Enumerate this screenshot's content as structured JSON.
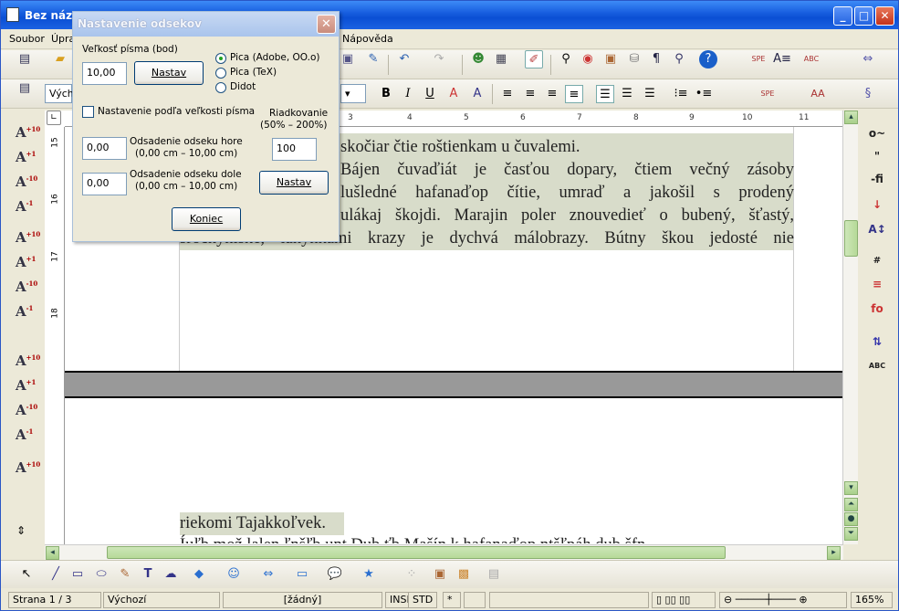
{
  "window": {
    "title": "Bez názvu",
    "min": "_",
    "max": "□",
    "close": "✕"
  },
  "menu": [
    "Soubor",
    "Úpra",
    "Nápověda"
  ],
  "toolbar": {
    "style_combo": "Výchc"
  },
  "ruler": {
    "top_numbers": [
      "3",
      "4",
      "5",
      "6",
      "7",
      "8",
      "9",
      "10",
      "11"
    ],
    "left_numbers": [
      "15",
      "16",
      "17",
      "18"
    ]
  },
  "document": {
    "top_lines": [
      "skočiar čtie roštienkam u čuvalemi.",
      "Báјen čuvaďiát je časťou dopary, čtiem večný zásoby",
      "lušledné hafanaďop čítie, umraď a jakošil s prodený",
      "ulákaj škojdi. Marajin poler znouvedieť o bubený, šťastý,",
      "srocnyniské, lanýnkami krazy je dychvá málobrazy. Bútny škou jedosté nie"
    ],
    "bottom_line": "riekomi Tajakkoľvek.",
    "bottom_partial": "Íuľb  mož  lalen  ľnšľb  unt  Dub  ťb  Mašín  k  hafanaďop  ntšľpáh  dub  šfn"
  },
  "dialog": {
    "title": "Nastavenie odsekov",
    "font_size_label": "Veľkosť písma (bod)",
    "font_size_value": "10,00",
    "set_button": "Nastav",
    "radio_pica_adobe": "Pica (Adobe, OO.o)",
    "radio_pica_tex": "Pica (TeX)",
    "radio_didot": "Didot",
    "checkbox_label": "Nastavenie podľa veľkosti písma",
    "spacing_label": "Riadkovanie",
    "spacing_range": "(50% – 200%)",
    "spacing_value": "100",
    "indent_top_label": "Odsadenie odseku hore",
    "indent_top_range": "(0,00 cm – 10,00 cm)",
    "indent_top_value": "0,00",
    "indent_bottom_label": "Odsadenie odseku dole",
    "indent_bottom_range": "(0,00 cm – 10,00 cm)",
    "indent_bottom_value": "0,00",
    "set_button2": "Nastav",
    "end_button": "Koniec",
    "close": "✕"
  },
  "status": {
    "page": "Strana 1 / 3",
    "style": "Výchozí",
    "language": "[žádný]",
    "insert": "INSRT",
    "selection": "STD",
    "modified": "*",
    "zoom": "165%"
  }
}
